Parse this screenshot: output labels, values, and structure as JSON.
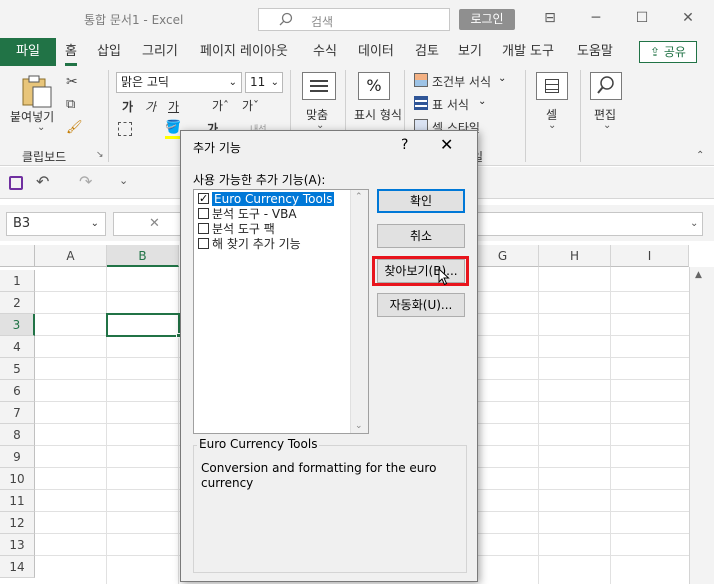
{
  "window": {
    "title": "통합 문서1  -  Excel",
    "search_placeholder": "검색",
    "login_label": "로그인",
    "minimize": "─",
    "restore": "☐",
    "close": "✕",
    "ribbon_icon": "⊟"
  },
  "tabs": {
    "file": "파일",
    "items": [
      "홈",
      "삽입",
      "그리기",
      "페이지 레이아웃",
      "수식",
      "데이터",
      "검토",
      "보기",
      "개발 도구",
      "도움말"
    ],
    "share": "공유"
  },
  "ribbon": {
    "paste_label": "붙여넣기",
    "clipboard_group": "클립보드",
    "font_name": "맑은 고딕",
    "font_size": "11",
    "bold": "가",
    "italic": "가",
    "underline": "가",
    "grow_font": "가ˆ",
    "shrink_font": "가ˇ",
    "align_label": "맞춤",
    "number_label": "표시 형식",
    "percent": "%",
    "conditional_format": "조건부 서식",
    "table_format": "표 서식",
    "cell_style": "셀 스타일",
    "cells_label": "셀",
    "editing_label": "편집",
    "styles_group_partial": "일",
    "font_group_partial": "내선"
  },
  "formula_bar": {
    "name_box": "B3",
    "cancel": "✕"
  },
  "grid": {
    "columns": [
      "A",
      "B",
      "C",
      "D",
      "E",
      "F",
      "G",
      "H",
      "I"
    ],
    "rows": [
      "1",
      "2",
      "3",
      "4",
      "5",
      "6",
      "7",
      "8",
      "9",
      "10",
      "11",
      "12",
      "13",
      "14"
    ],
    "selected_cell": "B3"
  },
  "dialog": {
    "title": "추가 기능",
    "help": "?",
    "close": "✕",
    "list_label": "사용 가능한 추가 기능(A):",
    "addins": [
      {
        "label": "Euro Currency Tools",
        "checked": true,
        "selected": true
      },
      {
        "label": "분석 도구 - VBA",
        "checked": false,
        "selected": false
      },
      {
        "label": "분석 도구 팩",
        "checked": false,
        "selected": false
      },
      {
        "label": "해 찾기 추가 기능",
        "checked": false,
        "selected": false
      }
    ],
    "ok_label": "확인",
    "cancel_label": "취소",
    "browse_label": "찾아보기(B)...",
    "automation_label": "자동화(U)...",
    "description_title": "Euro Currency Tools",
    "description_text": "Conversion and formatting for the euro currency"
  },
  "colors": {
    "excel_green": "#217346",
    "highlight_red": "#e8141c",
    "selection_blue": "#0078d7"
  }
}
